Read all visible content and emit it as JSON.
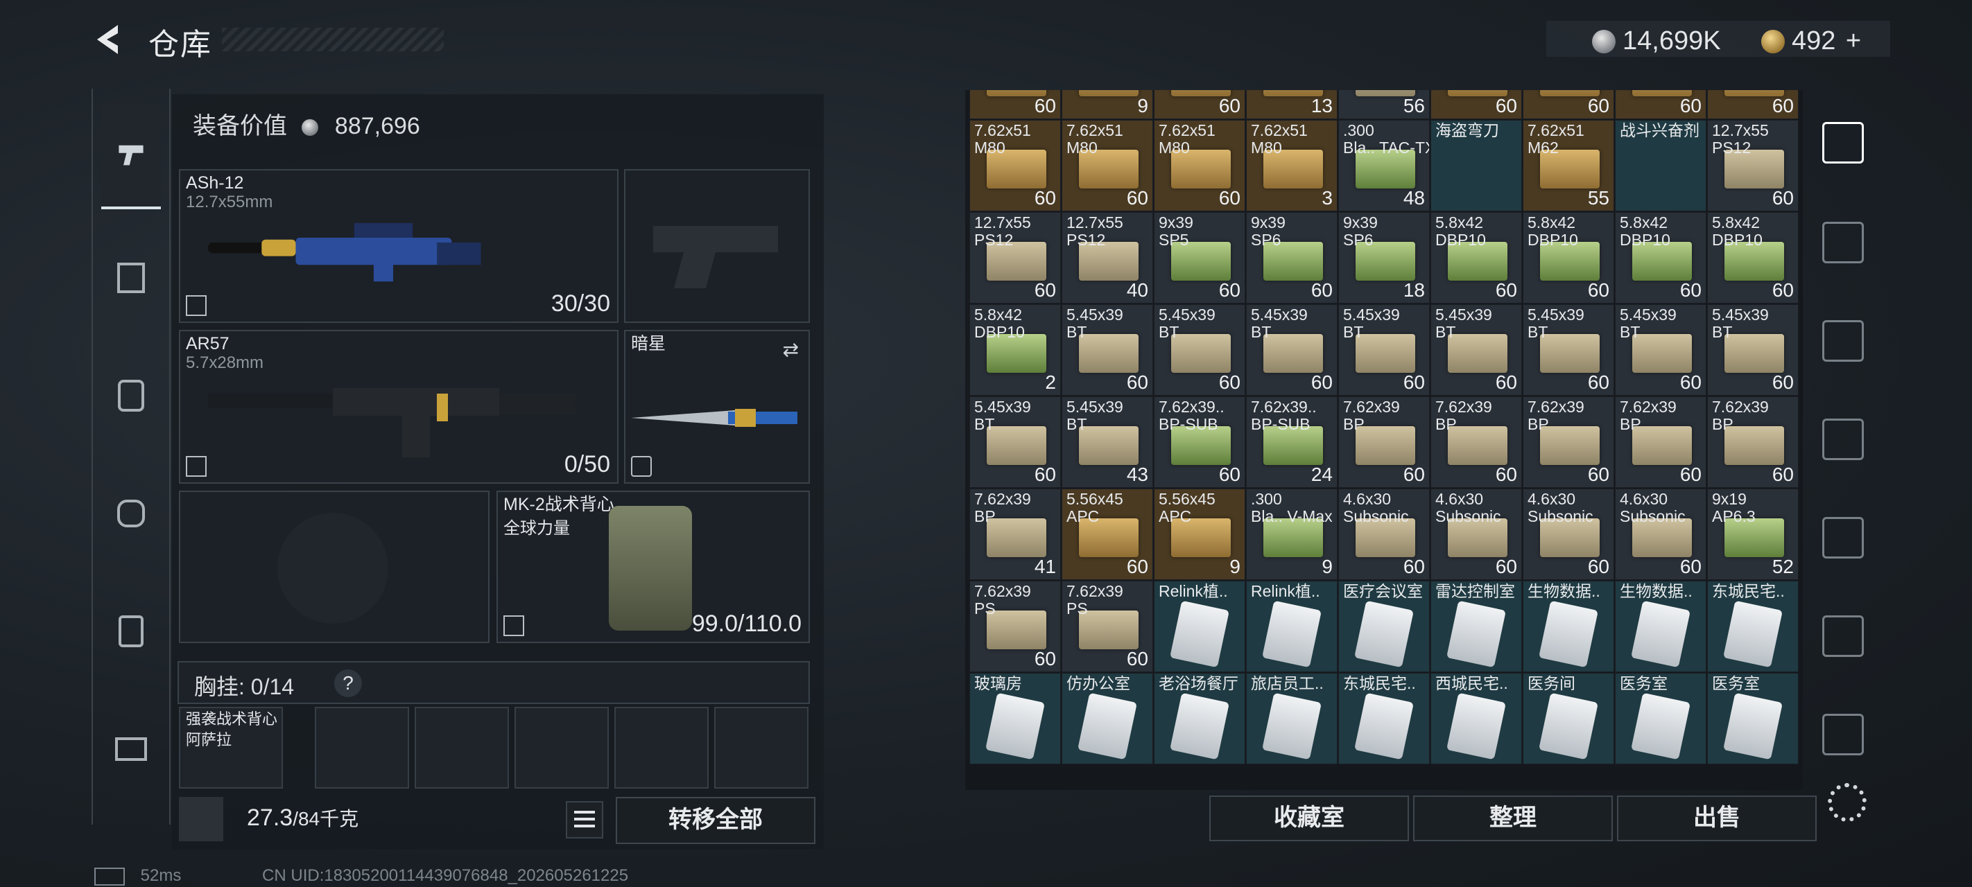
{
  "header": {
    "title": "仓库",
    "silver": "14,699K",
    "gold": "492",
    "gold_add": "+"
  },
  "loadout": {
    "equip_value_label": "装备价值",
    "equip_value": "887,696",
    "primary": {
      "name": "ASh-12",
      "caliber": "12.7x55mm",
      "ammo": "30/30"
    },
    "secondary": {
      "name": "AR57",
      "caliber": "5.7x28mm",
      "ammo": "0/50"
    },
    "melee": {
      "name": "暗星"
    },
    "armor": {
      "name": "MK-2战术背心",
      "sub": "全球力量",
      "durability": "99.0/110.0"
    },
    "chest": {
      "label": "胸挂:",
      "value": "0/14",
      "help": "?"
    },
    "rig": {
      "name": "强袭战术背心",
      "sub": "阿萨拉"
    },
    "weight": "27.3",
    "weight_max": "/84千克",
    "transfer_all": "转移全部"
  },
  "inventory": {
    "rows": [
      [
        {
          "n": "",
          "c": "60",
          "t": "gold"
        },
        {
          "n": "",
          "c": "9",
          "t": "gold"
        },
        {
          "n": "",
          "c": "60",
          "t": "gold"
        },
        {
          "n": "",
          "c": "13",
          "t": "gold"
        },
        {
          "n": "",
          "c": "56",
          "t": "box"
        },
        {
          "n": "",
          "c": "60",
          "t": "gold"
        },
        {
          "n": "",
          "c": "60",
          "t": "gold"
        },
        {
          "n": "",
          "c": "60",
          "t": "gold"
        },
        {
          "n": "",
          "c": "60",
          "t": "gold"
        }
      ],
      [
        {
          "n": "7.62x51 M80",
          "c": "60",
          "t": "gold"
        },
        {
          "n": "7.62x51 M80",
          "c": "60",
          "t": "gold"
        },
        {
          "n": "7.62x51 M80",
          "c": "60",
          "t": "gold"
        },
        {
          "n": "7.62x51 M80",
          "c": "3",
          "t": "gold"
        },
        {
          "n": ".300 Bla.. TAC-TX",
          "c": "48",
          "t": "green"
        },
        {
          "n": "海盗弯刀",
          "c": "",
          "t": "item"
        },
        {
          "n": "7.62x51 M62",
          "c": "55",
          "t": "gold"
        },
        {
          "n": "战斗兴奋剂",
          "c": "",
          "t": "item"
        },
        {
          "n": "12.7x55 PS12",
          "c": "60",
          "t": "box"
        }
      ],
      [
        {
          "n": "12.7x55 PS12",
          "c": "60",
          "t": "box"
        },
        {
          "n": "12.7x55 PS12",
          "c": "40",
          "t": "box"
        },
        {
          "n": "9x39 SP5",
          "c": "60",
          "t": "green"
        },
        {
          "n": "9x39 SP6",
          "c": "60",
          "t": "green"
        },
        {
          "n": "9x39 SP6",
          "c": "18",
          "t": "green"
        },
        {
          "n": "5.8x42 DBP10",
          "c": "60",
          "t": "green"
        },
        {
          "n": "5.8x42 DBP10",
          "c": "60",
          "t": "green"
        },
        {
          "n": "5.8x42 DBP10",
          "c": "60",
          "t": "green"
        },
        {
          "n": "5.8x42 DBP10",
          "c": "60",
          "t": "green"
        }
      ],
      [
        {
          "n": "5.8x42 DBP10",
          "c": "2",
          "t": "green"
        },
        {
          "n": "5.45x39 BT",
          "c": "60",
          "t": "box"
        },
        {
          "n": "5.45x39 BT",
          "c": "60",
          "t": "box"
        },
        {
          "n": "5.45x39 BT",
          "c": "60",
          "t": "box"
        },
        {
          "n": "5.45x39 BT",
          "c": "60",
          "t": "box"
        },
        {
          "n": "5.45x39 BT",
          "c": "60",
          "t": "box"
        },
        {
          "n": "5.45x39 BT",
          "c": "60",
          "t": "box"
        },
        {
          "n": "5.45x39 BT",
          "c": "60",
          "t": "box"
        },
        {
          "n": "5.45x39 BT",
          "c": "60",
          "t": "box"
        }
      ],
      [
        {
          "n": "5.45x39 BT",
          "c": "60",
          "t": "box"
        },
        {
          "n": "5.45x39 BT",
          "c": "43",
          "t": "box"
        },
        {
          "n": "7.62x39.. BP-SUB",
          "c": "60",
          "t": "green"
        },
        {
          "n": "7.62x39.. BP-SUB",
          "c": "24",
          "t": "green"
        },
        {
          "n": "7.62x39 BP",
          "c": "60",
          "t": "box"
        },
        {
          "n": "7.62x39 BP",
          "c": "60",
          "t": "box"
        },
        {
          "n": "7.62x39 BP",
          "c": "60",
          "t": "box"
        },
        {
          "n": "7.62x39 BP",
          "c": "60",
          "t": "box"
        },
        {
          "n": "7.62x39 BP",
          "c": "60",
          "t": "box"
        }
      ],
      [
        {
          "n": "7.62x39 BP",
          "c": "41",
          "t": "box"
        },
        {
          "n": "5.56x45 APC",
          "c": "60",
          "t": "gold"
        },
        {
          "n": "5.56x45 APC",
          "c": "9",
          "t": "gold"
        },
        {
          "n": ".300 Bla.. V-Max",
          "c": "9",
          "t": "green"
        },
        {
          "n": "4.6x30 Subsonic",
          "c": "60",
          "t": "box"
        },
        {
          "n": "4.6x30 Subsonic",
          "c": "60",
          "t": "box"
        },
        {
          "n": "4.6x30 Subsonic",
          "c": "60",
          "t": "box"
        },
        {
          "n": "4.6x30 Subsonic",
          "c": "60",
          "t": "box"
        },
        {
          "n": "9x19 AP6.3",
          "c": "52",
          "t": "green"
        }
      ],
      [
        {
          "n": "7.62x39 PS",
          "c": "60",
          "t": "box"
        },
        {
          "n": "7.62x39 PS",
          "c": "60",
          "t": "box"
        },
        {
          "n": "Relink植..",
          "c": "",
          "t": "bag"
        },
        {
          "n": "Relink植..",
          "c": "",
          "t": "bag"
        },
        {
          "n": "医疗会议室",
          "c": "",
          "t": "bag"
        },
        {
          "n": "雷达控制室",
          "c": "",
          "t": "bag"
        },
        {
          "n": "生物数据..",
          "c": "",
          "t": "bag"
        },
        {
          "n": "生物数据..",
          "c": "",
          "t": "bag"
        },
        {
          "n": "东城民宅..",
          "c": "",
          "t": "bag"
        }
      ],
      [
        {
          "n": "玻璃房",
          "c": "",
          "t": "bag"
        },
        {
          "n": "仿办公室",
          "c": "",
          "t": "bag"
        },
        {
          "n": "老浴场餐厅",
          "c": "",
          "t": "bag"
        },
        {
          "n": "旅店员工..",
          "c": "",
          "t": "bag"
        },
        {
          "n": "东城民宅..",
          "c": "",
          "t": "bag"
        },
        {
          "n": "西城民宅..",
          "c": "",
          "t": "bag"
        },
        {
          "n": "医务间",
          "c": "",
          "t": "bag"
        },
        {
          "n": "医务室",
          "c": "",
          "t": "bag"
        },
        {
          "n": "医务室",
          "c": "",
          "t": "bag"
        }
      ]
    ]
  },
  "buttons": {
    "collection": "收藏室",
    "sort": "整理",
    "sell": "出售"
  },
  "status": {
    "ping": "52ms",
    "uid": "CN UID:183052001144390768​48_202605261225"
  }
}
